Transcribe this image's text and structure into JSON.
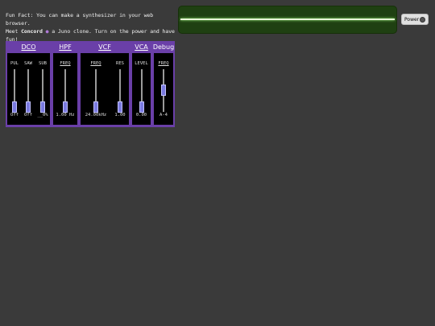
{
  "fun_fact": {
    "line1": "Fun Fact: You can make a synthesizer in your web browser.",
    "meet": "Meet",
    "concord": "Concord",
    "line2_rest": "a Juno clone. Turn on the power and have fun!"
  },
  "power": {
    "label": "Power",
    "on": false
  },
  "sections": {
    "dco": "DCO",
    "hpf": "HPF",
    "vcf": "VCF",
    "vca": "VCA",
    "debug": "Debug"
  },
  "sliders": {
    "dco_pul": {
      "label": "PUL",
      "value": "Off",
      "level": 0
    },
    "dco_saw": {
      "label": "SAW",
      "value": "Off",
      "level": 0
    },
    "dco_sub": {
      "label": "SUB",
      "value": "__0%",
      "level": 0
    },
    "hpf_freq": {
      "label": "FREQ",
      "value": "1.00 Hz",
      "level": 0
    },
    "vcf_freq": {
      "label": "FREQ",
      "value": "24.00kHz",
      "level": 0
    },
    "vcf_res": {
      "label": "RES",
      "value": "1.00",
      "level": 0
    },
    "vca_level": {
      "label": "LEVEL",
      "value": "0.00",
      "level": 0
    },
    "debug_freq": {
      "label": "FREQ",
      "value": "A-4",
      "level": 0.55
    }
  }
}
